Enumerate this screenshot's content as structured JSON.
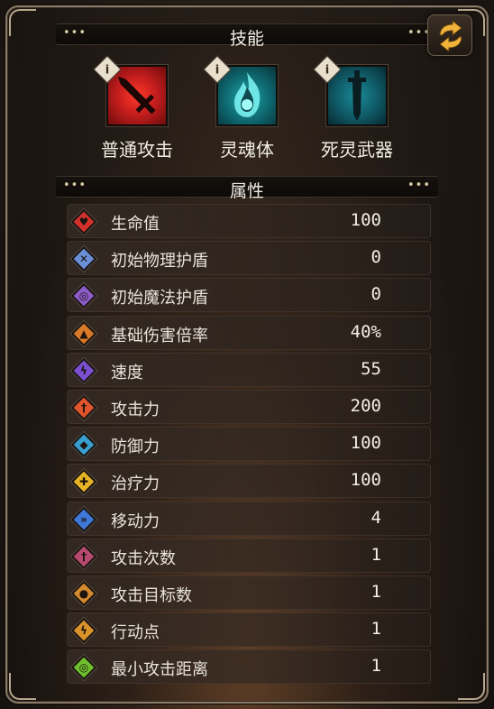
{
  "skills_header": {
    "title": "技能"
  },
  "skills": [
    {
      "label": "普通攻击",
      "icon": "sword-strike-icon",
      "color": "#c81e1e",
      "info": "i"
    },
    {
      "label": "灵魂体",
      "icon": "soul-flame-icon",
      "color": "#0f6b72",
      "info": "i"
    },
    {
      "label": "死灵武器",
      "icon": "necro-sword-icon",
      "color": "#0f5864",
      "info": "i"
    }
  ],
  "attributes_header": {
    "title": "属性"
  },
  "stats": [
    {
      "name": "生命值",
      "value": "100",
      "icon": "heart-icon",
      "color": "#d3322c"
    },
    {
      "name": "初始物理护盾",
      "value": "0",
      "icon": "physical-shield-icon",
      "color": "#6b8fd6"
    },
    {
      "name": "初始魔法护盾",
      "value": "0",
      "icon": "magic-shield-icon",
      "color": "#8d5cc9"
    },
    {
      "name": "基础伤害倍率",
      "value": "40%",
      "icon": "damage-multiplier-icon",
      "color": "#d97a2a"
    },
    {
      "name": "速度",
      "value": "55",
      "icon": "speed-icon",
      "color": "#7b4fd0"
    },
    {
      "name": "攻击力",
      "value": "200",
      "icon": "attack-icon",
      "color": "#e0552e"
    },
    {
      "name": "防御力",
      "value": "100",
      "icon": "defense-icon",
      "color": "#3a9fd0"
    },
    {
      "name": "治疗力",
      "value": "100",
      "icon": "heal-icon",
      "color": "#e6b427"
    },
    {
      "name": "移动力",
      "value": "4",
      "icon": "move-icon",
      "color": "#3f78d8"
    },
    {
      "name": "攻击次数",
      "value": "1",
      "icon": "attack-count-icon",
      "color": "#b84a72"
    },
    {
      "name": "攻击目标数",
      "value": "1",
      "icon": "attack-targets-icon",
      "color": "#d48a2e"
    },
    {
      "name": "行动点",
      "value": "1",
      "icon": "action-point-icon",
      "color": "#d9932a"
    },
    {
      "name": "最小攻击距离",
      "value": "1",
      "icon": "min-range-icon",
      "color": "#6fbf2e"
    }
  ],
  "header_ornament": "•••",
  "swap_button": {
    "icon": "swap-arrows-icon",
    "color": "#f0b23a"
  }
}
